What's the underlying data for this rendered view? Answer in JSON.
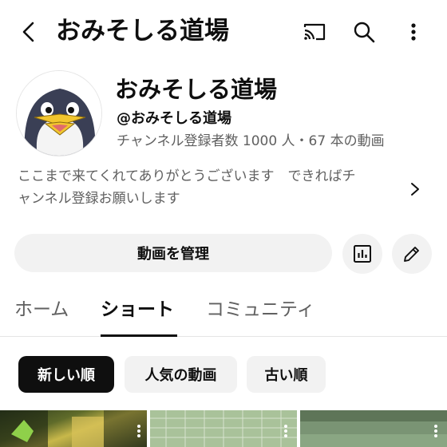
{
  "topbar": {
    "title": "おみそしる道場",
    "icons": [
      "back-arrow-icon",
      "cast-icon",
      "search-icon",
      "more-vert-icon"
    ]
  },
  "channel": {
    "name": "おみそしる道場",
    "handle": "@おみそしる道場",
    "stats": "チャンネル登録者数 1000 人・67 本の動画",
    "description_line1": "ここまで来てくれてありがとうございます　できればチ",
    "description_line2": "ャンネル登録お願いします"
  },
  "actions": {
    "manage_label": "動画を管理",
    "icons": [
      "analytics-icon",
      "edit-pencil-icon"
    ]
  },
  "tabs": [
    {
      "label": "ホーム",
      "active": false
    },
    {
      "label": "ショート",
      "active": true
    },
    {
      "label": "コミュニティ",
      "active": false
    }
  ],
  "chips": [
    {
      "label": "新しい順",
      "selected": true
    },
    {
      "label": "人気の動画",
      "selected": false
    },
    {
      "label": "古い順",
      "selected": false
    }
  ],
  "colors": {
    "text_primary": "#0f0f0f",
    "text_secondary": "#606060",
    "button_bg": "#f2f2f2",
    "chip_selected_bg": "#0f0f0f"
  }
}
